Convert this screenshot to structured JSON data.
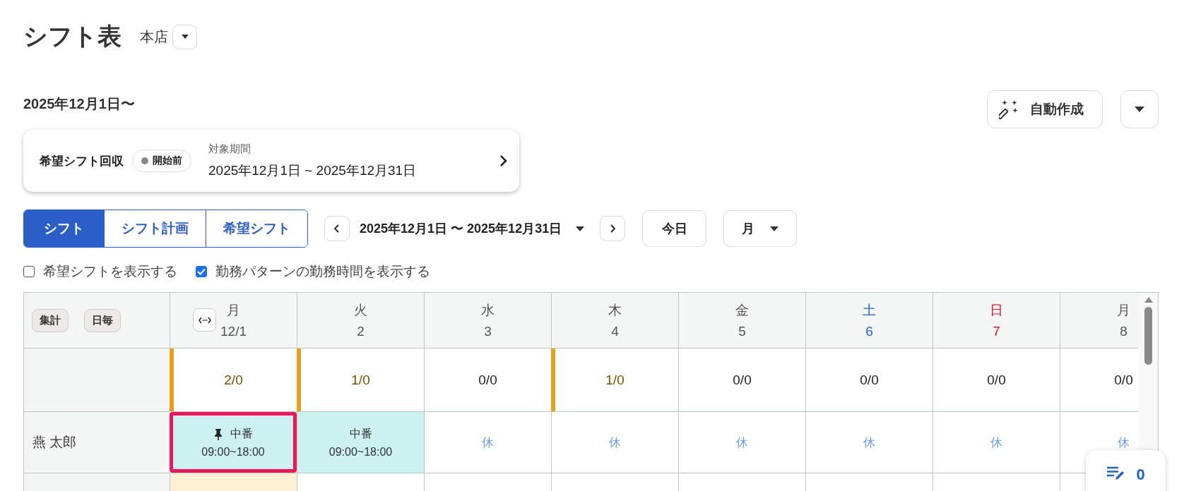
{
  "page": {
    "title": "シフト表",
    "store": "本店"
  },
  "period_heading": "2025年12月1日〜",
  "collection_card": {
    "title": "希望シフト回収",
    "status": "開始前",
    "period_label": "対象期間",
    "period": "2025年12月1日 ~ 2025年12月31日"
  },
  "actions": {
    "auto_create": "自動作成"
  },
  "tabs": [
    {
      "label": "シフト",
      "selected": true
    },
    {
      "label": "シフト計画",
      "selected": false
    },
    {
      "label": "希望シフト",
      "selected": false
    }
  ],
  "range": "2025年12月1日 〜 2025年12月31日",
  "today_button": "今日",
  "view_select": "月",
  "options": [
    {
      "label": "希望シフトを表示する",
      "checked": false
    },
    {
      "label": "勤務パターンの勤務時間を表示する",
      "checked": true
    }
  ],
  "grid": {
    "buttons": [
      "集計",
      "日毎"
    ],
    "days": [
      {
        "weekday": "月",
        "date": "12/1",
        "kind": "weekday",
        "summary": "2/0",
        "warning": true,
        "highlighted": true
      },
      {
        "weekday": "火",
        "date": "2",
        "kind": "weekday",
        "summary": "1/0",
        "warning": true,
        "highlighted": false
      },
      {
        "weekday": "水",
        "date": "3",
        "kind": "weekday",
        "summary": "0/0",
        "warning": false,
        "highlighted": false
      },
      {
        "weekday": "木",
        "date": "4",
        "kind": "weekday",
        "summary": "1/0",
        "warning": true,
        "highlighted": false
      },
      {
        "weekday": "金",
        "date": "5",
        "kind": "weekday",
        "summary": "0/0",
        "warning": false,
        "highlighted": false
      },
      {
        "weekday": "土",
        "date": "6",
        "kind": "saturday",
        "summary": "0/0",
        "warning": false,
        "highlighted": false
      },
      {
        "weekday": "日",
        "date": "7",
        "kind": "sunday",
        "summary": "0/0",
        "warning": false,
        "highlighted": false
      },
      {
        "weekday": "月",
        "date": "8",
        "kind": "weekday",
        "summary": "0/0",
        "warning": false,
        "highlighted": false
      }
    ],
    "rows": [
      {
        "name": "燕 太郎",
        "cells": [
          {
            "kind": "shift",
            "label": "中番",
            "time": "09:00~18:00",
            "pinned": true,
            "selected": true
          },
          {
            "kind": "shift",
            "label": "中番",
            "time": "09:00~18:00",
            "pinned": false,
            "selected": false
          },
          {
            "kind": "off",
            "label": "休",
            "selected": false
          },
          {
            "kind": "off",
            "label": "休",
            "selected": false
          },
          {
            "kind": "off",
            "label": "休",
            "selected": false
          },
          {
            "kind": "off",
            "label": "休",
            "selected": false
          },
          {
            "kind": "off",
            "label": "休",
            "selected": false
          },
          {
            "kind": "off",
            "label": "休",
            "selected": false
          }
        ]
      }
    ]
  },
  "notes_button": {
    "count": "0"
  }
}
